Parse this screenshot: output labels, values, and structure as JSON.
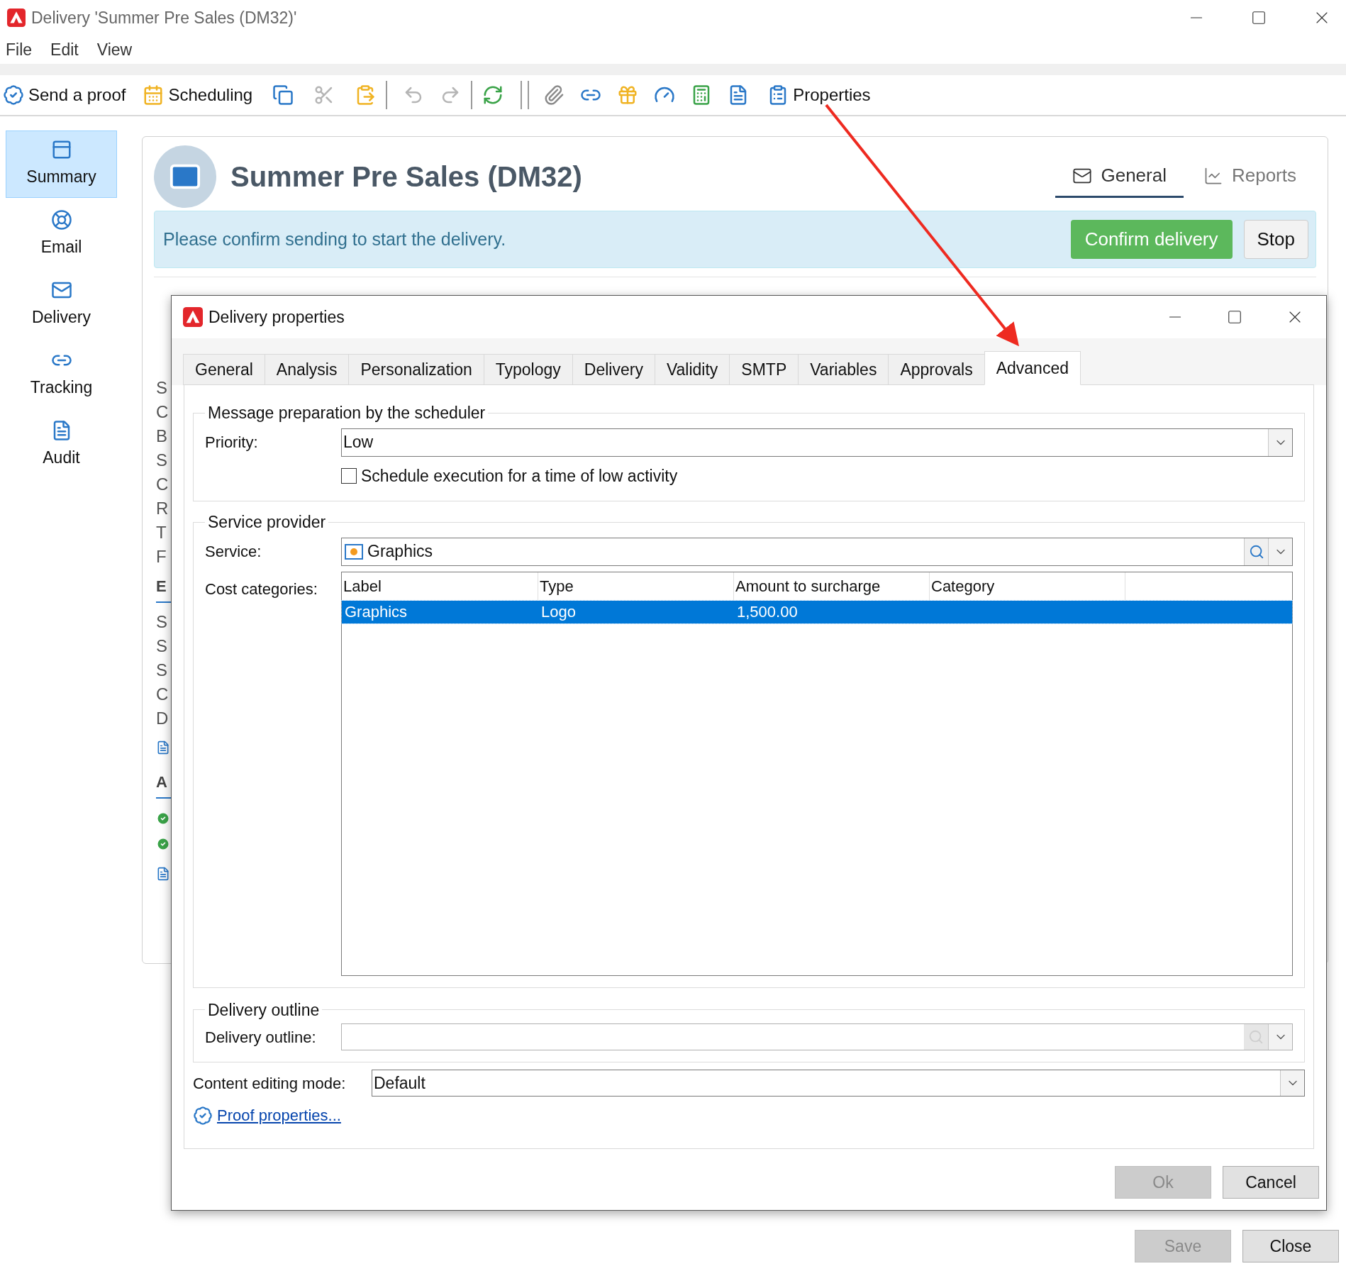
{
  "window": {
    "title": "Delivery 'Summer Pre Sales (DM32)'"
  },
  "menu": [
    "File",
    "Edit",
    "View"
  ],
  "toolbar": {
    "send_proof": "Send a proof",
    "scheduling": "Scheduling",
    "properties": "Properties"
  },
  "sidebar": {
    "items": [
      {
        "label": "Summary",
        "selected": true
      },
      {
        "label": "Email",
        "selected": false
      },
      {
        "label": "Delivery",
        "selected": false
      },
      {
        "label": "Tracking",
        "selected": false
      },
      {
        "label": "Audit",
        "selected": false
      }
    ]
  },
  "delivery": {
    "title": "Summer Pre Sales (DM32)",
    "view_tabs": [
      {
        "label": "General",
        "selected": true
      },
      {
        "label": "Reports",
        "selected": false
      }
    ],
    "message": "Please confirm sending to start the delivery.",
    "confirm_button": "Confirm delivery",
    "stop_button": "Stop",
    "fragments": [
      {
        "kind": "letter",
        "text": "S"
      },
      {
        "kind": "letter",
        "text": "C"
      },
      {
        "kind": "letter",
        "text": "B"
      },
      {
        "kind": "letter",
        "text": "S"
      },
      {
        "kind": "letter",
        "text": "C"
      },
      {
        "kind": "letter",
        "text": "R"
      },
      {
        "kind": "letter",
        "text": "T"
      },
      {
        "kind": "letter",
        "text": "F"
      },
      {
        "kind": "heading",
        "text": "E"
      },
      {
        "kind": "letter",
        "text": "S"
      },
      {
        "kind": "letter",
        "text": "S"
      },
      {
        "kind": "letter",
        "text": "S"
      },
      {
        "kind": "letter",
        "text": "C"
      },
      {
        "kind": "letter",
        "text": "D"
      },
      {
        "kind": "document"
      },
      {
        "kind": "heading",
        "text": "A"
      },
      {
        "kind": "check"
      },
      {
        "kind": "check"
      },
      {
        "kind": "document"
      }
    ]
  },
  "dialog": {
    "title": "Delivery properties",
    "tabs": [
      {
        "label": "General",
        "selected": false
      },
      {
        "label": "Analysis",
        "selected": false
      },
      {
        "label": "Personalization",
        "selected": false
      },
      {
        "label": "Typology",
        "selected": false
      },
      {
        "label": "Delivery",
        "selected": false
      },
      {
        "label": "Validity",
        "selected": false
      },
      {
        "label": "SMTP",
        "selected": false
      },
      {
        "label": "Variables",
        "selected": false
      },
      {
        "label": "Approvals",
        "selected": false
      },
      {
        "label": "Advanced",
        "selected": true
      }
    ],
    "scheduler": {
      "legend": "Message preparation by the scheduler",
      "priority_label": "Priority:",
      "priority": "Low",
      "low_activity": {
        "label": "Schedule execution for a time of low activity",
        "checked": false
      }
    },
    "service_provider": {
      "legend": "Service provider",
      "service_label": "Service:",
      "service": "Graphics",
      "cost_label": "Cost categories:",
      "table": {
        "columns": [
          "Label",
          "Type",
          "Amount to surcharge",
          "Category"
        ],
        "rows": [
          {
            "cells": [
              "Graphics",
              "Logo",
              "1,500.00",
              ""
            ],
            "selected": true
          }
        ]
      }
    },
    "outline": {
      "legend": "Delivery outline",
      "label": "Delivery outline:"
    },
    "content_mode": {
      "label": "Content editing mode:",
      "value": "Default"
    },
    "proof_link": "Proof properties...",
    "buttons": [
      {
        "label": "Ok",
        "disabled": true
      },
      {
        "label": "Cancel",
        "disabled": false
      }
    ]
  },
  "footer_buttons": [
    {
      "label": "Save",
      "disabled": true
    },
    {
      "label": "Close",
      "disabled": false
    }
  ]
}
